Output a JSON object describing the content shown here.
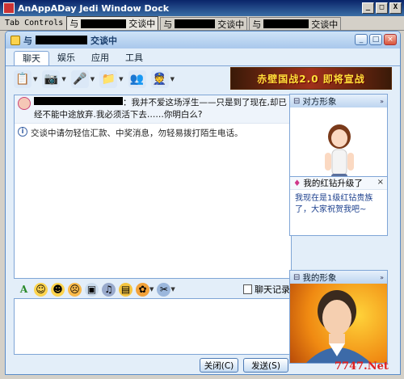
{
  "app": {
    "title": "AnAppADay Jedi Window Dock",
    "window_buttons": [
      "_",
      "□",
      "X"
    ]
  },
  "dock": {
    "label": "Tab Controls",
    "tabs": [
      {
        "prefix": "与",
        "suffix": "交谈中",
        "active": true
      },
      {
        "prefix": "与",
        "suffix": "交谈中",
        "active": false
      },
      {
        "prefix": "与",
        "suffix": "交谈中",
        "active": false
      }
    ]
  },
  "qq": {
    "title_prefix": "与",
    "title_suffix": "交谈中",
    "window_buttons": [
      "_",
      "□",
      "×"
    ],
    "nav_tabs": [
      "聊天",
      "娱乐",
      "应用",
      "工具"
    ],
    "ad_text": "赤壁国战2.0 即将宣战",
    "history": {
      "message": "：我并不爱这场浮生——只是到了现在,却已经不能中途放弃.我必须活下去……你明白么?",
      "notice": "交谈中请勿轻信汇款、中奖消息，勿轻易拨打陌生电话。"
    },
    "input_toolbar": {
      "history_label": "聊天记录"
    },
    "buttons": {
      "close": "关闭(C)",
      "send": "发送(S)"
    },
    "right": {
      "peer_panel_title": "对方形象",
      "notif_title": "我的红钻升级了",
      "notif_body": "我现在是1级红钻贵族了，大家祝贺我吧~",
      "my_panel_title": "我的形象"
    }
  },
  "watermark": "7747.Net",
  "colors": {
    "titlebar": "#0a246a",
    "qq_bg": "#e3eef9",
    "ad_text": "#ffe23a",
    "watermark": "#e02020"
  }
}
